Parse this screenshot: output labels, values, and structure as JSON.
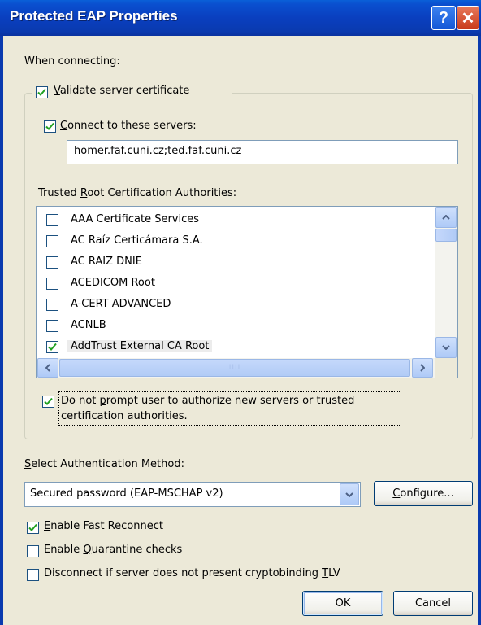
{
  "window": {
    "title": "Protected EAP Properties",
    "help_glyph": "?",
    "close_glyph": "✕"
  },
  "connecting": {
    "label": "When connecting:",
    "validate": {
      "prefix": "",
      "mnemonic": "V",
      "suffix": "alidate server certificate",
      "checked": true
    },
    "connect": {
      "prefix": "",
      "mnemonic": "C",
      "suffix": "onnect to these servers:",
      "checked": true
    },
    "servers_value": "homer.faf.cuni.cz;ted.faf.cuni.cz"
  },
  "trusted": {
    "label_prefix": "Trusted ",
    "label_mnemonic": "R",
    "label_suffix": "oot Certification Authorities:",
    "items": [
      {
        "label": "AAA Certificate Services",
        "checked": false
      },
      {
        "label": "AC Raíz Certicámara S.A.",
        "checked": false
      },
      {
        "label": "AC RAIZ DNIE",
        "checked": false
      },
      {
        "label": "ACEDICOM Root",
        "checked": false
      },
      {
        "label": "A-CERT ADVANCED",
        "checked": false
      },
      {
        "label": "ACNLB",
        "checked": false
      },
      {
        "label": "AddTrust External CA Root",
        "checked": true
      }
    ],
    "hscroll_grip": "IIII"
  },
  "no_prompt": {
    "checked": true,
    "line1_prefix": "Do not ",
    "line1_mnemonic": "p",
    "line1_suffix": "rompt user to authorize new servers or trusted",
    "line2": "certification authorities."
  },
  "auth": {
    "label_prefix": "",
    "label_mnemonic": "S",
    "label_suffix": "elect Authentication Method:",
    "selected": "Secured password (EAP-MSCHAP v2)",
    "configure_mnemonic": "C",
    "configure_suffix": "onfigure..."
  },
  "options": {
    "fast_reconnect": {
      "mnemonic": "E",
      "suffix": "nable Fast Reconnect",
      "prefix": "",
      "checked": true
    },
    "quarantine": {
      "prefix": "Enable ",
      "mnemonic": "Q",
      "suffix": "uarantine checks",
      "checked": false
    },
    "cryptobinding": {
      "prefix": "Disconnect if server does not present cryptobinding ",
      "mnemonic": "T",
      "suffix": "LV",
      "checked": false
    }
  },
  "buttons": {
    "ok": "OK",
    "cancel": "Cancel"
  },
  "colors": {
    "titlebar": "#0a3aaf",
    "dialog_bg": "#ece9d8",
    "check": "#21a121"
  }
}
